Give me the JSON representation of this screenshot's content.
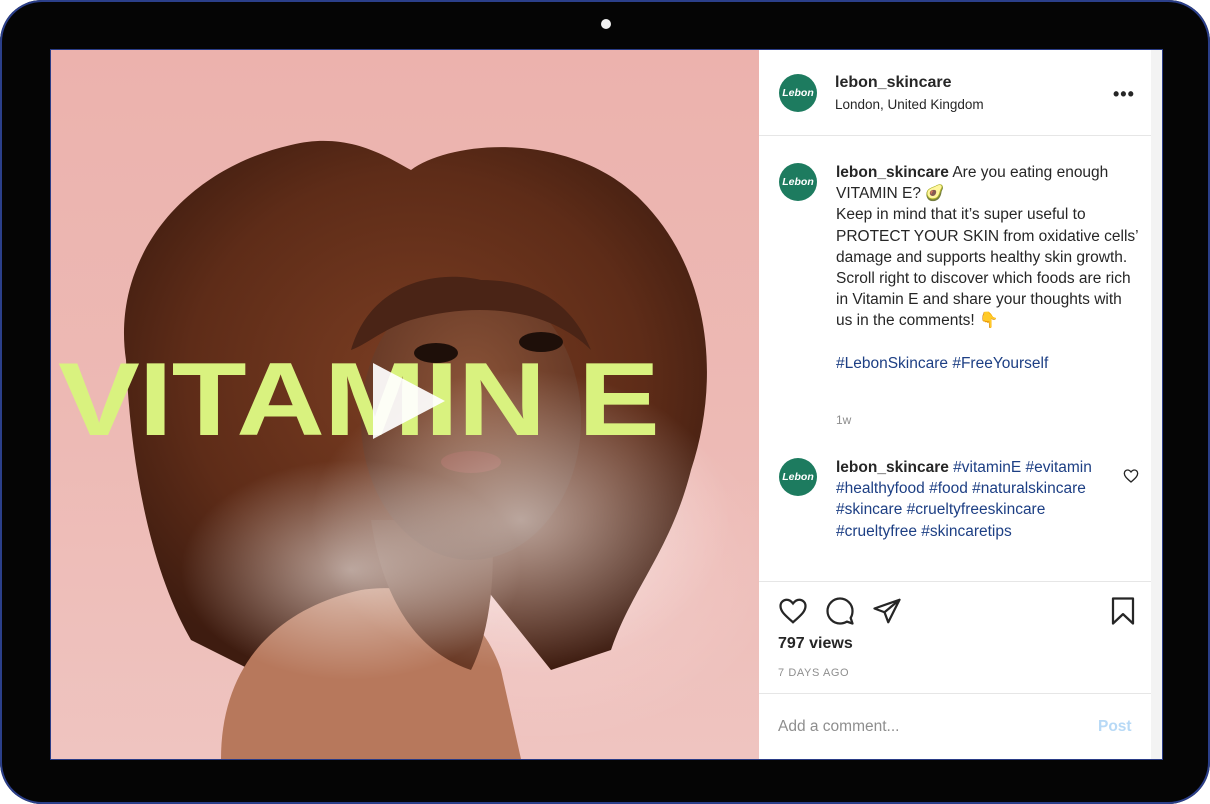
{
  "post": {
    "username": "lebon_skincare",
    "location": "London, United Kingdom",
    "avatar_text": "Lebon",
    "more_label": "•••",
    "media": {
      "overlay_text": "VITAMIN E",
      "overlay_color": "#d9f27f",
      "background_color": "#ecb2ad"
    },
    "caption": {
      "username": "lebon_skincare",
      "lines": [
        "Are you eating enough VITAMIN E? 🥑",
        "Keep in mind that it’s super useful to PROTECT YOUR SKIN from oxidative cells’ damage and supports healthy skin growth.",
        "Scroll right to discover which foods are rich in Vitamin E and share your thoughts with us in the comments! 👇"
      ],
      "hashtags": "#LebonSkincare #FreeYourself",
      "time": "1w"
    },
    "comment": {
      "username": "lebon_skincare",
      "hashtags": "#vitaminE #evitamin #healthyfood #food #naturalskincare #skincare #crueltyfreeskincare #crueltyfree #skincaretips"
    },
    "views": "797 views",
    "date": "7 DAYS AGO",
    "comment_placeholder": "Add a comment...",
    "post_label": "Post"
  },
  "icons": [
    "heart-icon",
    "comment-icon",
    "share-icon",
    "bookmark-icon",
    "play-icon"
  ],
  "colors": {
    "brand": "#1d7b5f",
    "hashtag": "#1d3f84",
    "post_button": "#b7d9f6"
  }
}
